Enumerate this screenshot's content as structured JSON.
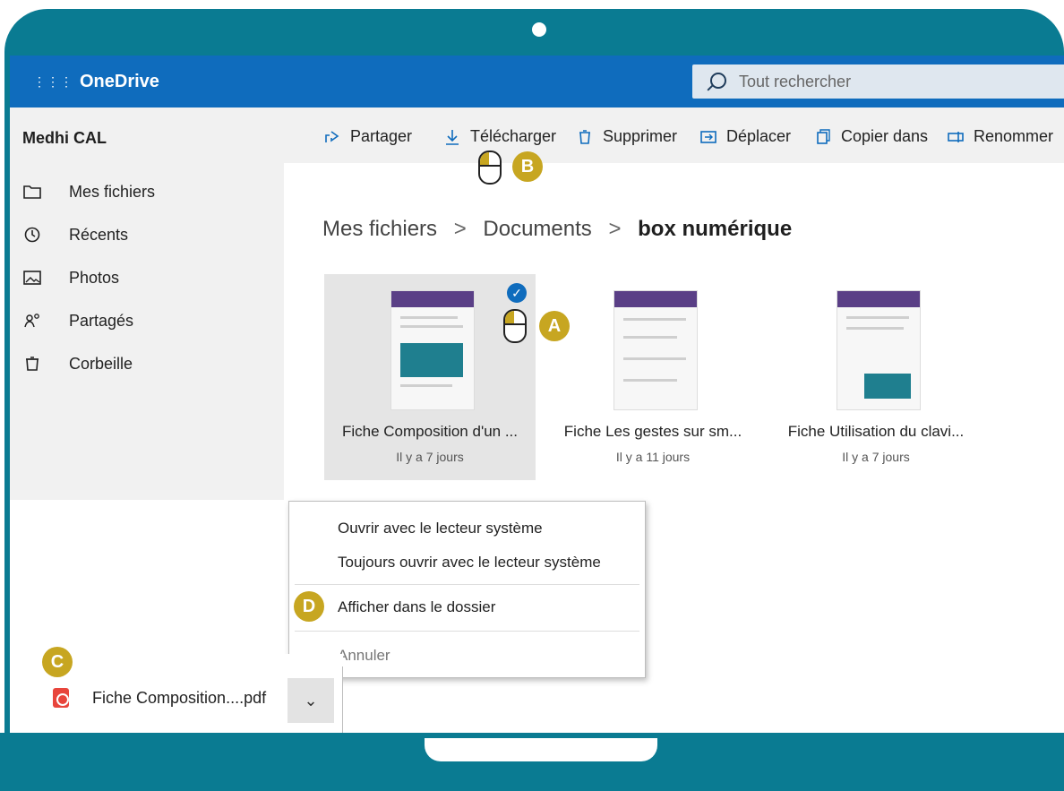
{
  "app": {
    "brand": "OneDrive",
    "search_placeholder": "Tout rechercher",
    "user": "Medhi CAL"
  },
  "sidebar": {
    "items": [
      {
        "label": "Mes fichiers",
        "icon": "folder-icon"
      },
      {
        "label": "Récents",
        "icon": "clock-icon"
      },
      {
        "label": "Photos",
        "icon": "image-icon"
      },
      {
        "label": "Partagés",
        "icon": "people-icon"
      },
      {
        "label": "Corbeille",
        "icon": "trash-icon"
      }
    ]
  },
  "toolbar": {
    "items": [
      {
        "label": "Partager",
        "icon": "share-icon"
      },
      {
        "label": "Télécharger",
        "icon": "download-icon"
      },
      {
        "label": "Supprimer",
        "icon": "delete-icon"
      },
      {
        "label": "Déplacer",
        "icon": "move-icon"
      },
      {
        "label": "Copier dans",
        "icon": "copy-icon"
      },
      {
        "label": "Renommer",
        "icon": "rename-icon"
      }
    ]
  },
  "breadcrumb": {
    "items": [
      "Mes fichiers",
      "Documents",
      "box numérique"
    ],
    "separator": ">"
  },
  "files": [
    {
      "name": "Fiche Composition d'un ...",
      "date": "Il y a 7 jours",
      "selected": true
    },
    {
      "name": "Fiche Les gestes sur sm...",
      "date": "Il y a 11 jours",
      "selected": false
    },
    {
      "name": "Fiche Utilisation du clavi...",
      "date": "Il y a 7 jours",
      "selected": false
    }
  ],
  "context_menu": {
    "items": [
      {
        "label": "Ouvrir avec le lecteur système"
      },
      {
        "label": "Toujours ouvrir avec le lecteur système"
      },
      {
        "label": "Afficher dans le dossier"
      },
      {
        "label": "Annuler",
        "disabled": true
      }
    ]
  },
  "download": {
    "file": "Fiche Composition....pdf"
  },
  "badges": {
    "a": "A",
    "b": "B",
    "c": "C",
    "d": "D"
  },
  "colors": {
    "bezel": "#0a7b92",
    "topbar": "#0f6cbd",
    "badge": "#c7a621"
  }
}
